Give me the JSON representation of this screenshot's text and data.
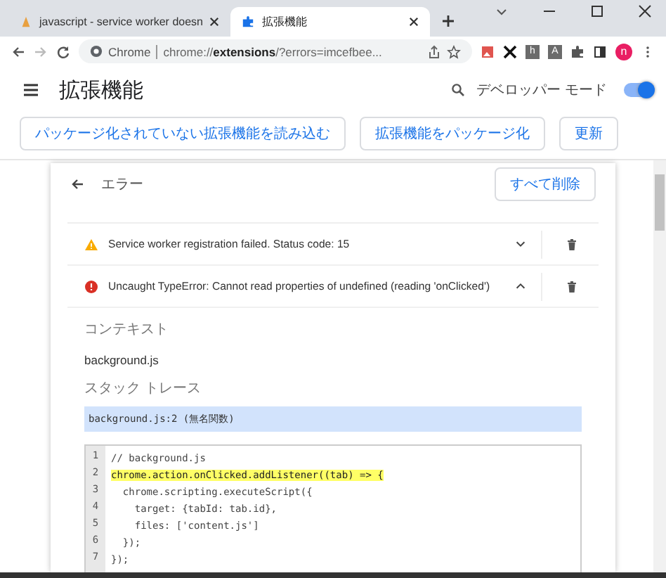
{
  "tabs": [
    {
      "title": "javascript - service worker doesn",
      "kind": "site",
      "selected": false
    },
    {
      "title": "拡張機能",
      "kind": "extension",
      "selected": true
    }
  ],
  "toolbar": {
    "site_label": "Chrome",
    "url": "chrome://**extensions**/?errors=imcefbee...",
    "extensions": [
      {
        "kind": "image"
      },
      {
        "kind": "x"
      },
      {
        "kind": "letter",
        "label": "h"
      },
      {
        "kind": "letter",
        "label": "A"
      },
      {
        "kind": "puzzle"
      },
      {
        "kind": "sidepanel"
      }
    ],
    "avatar": "n"
  },
  "header": {
    "title": "拡張機能",
    "dev_mode": {
      "label": "デベロッパー モード",
      "on": true
    }
  },
  "buttons": [
    "パッケージ化されていない拡張機能を読み込む",
    "拡張機能をパッケージ化",
    "更新"
  ],
  "panel": {
    "title": "エラー",
    "clear_all": "すべて削除",
    "errors": [
      {
        "kind": "warning",
        "message": "Service worker registration failed. Status code: 15",
        "expanded": false
      },
      {
        "kind": "error",
        "message": "Uncaught TypeError: Cannot read properties of undefined (reading 'onClicked')",
        "expanded": true
      }
    ],
    "context_label": "コンテキスト",
    "context": "background.js",
    "stack_label": "スタック トレース",
    "stack_frame": "background.js:2 (無名関数)",
    "code": [
      {
        "number": "1",
        "text": "// background.js",
        "highlighted": false
      },
      {
        "number": "2",
        "text": "chrome.action.onClicked.addListener((tab) => {",
        "highlighted": true
      },
      {
        "number": "3",
        "text": "  chrome.scripting.executeScript({",
        "highlighted": false
      },
      {
        "number": "4",
        "text": "    target: {tabId: tab.id},",
        "highlighted": false
      },
      {
        "number": "5",
        "text": "    files: ['content.js']",
        "highlighted": false
      },
      {
        "number": "6",
        "text": "  });",
        "highlighted": false
      },
      {
        "number": "7",
        "text": "});",
        "highlighted": false
      }
    ]
  }
}
